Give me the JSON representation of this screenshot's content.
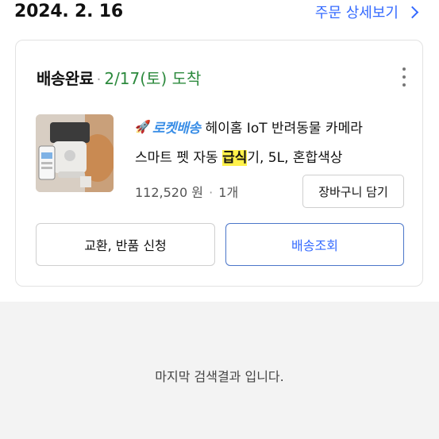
{
  "order": {
    "date": "2024. 2. 16",
    "detail_link_label": "주문 상세보기",
    "detail_link_icon": "chevron-right-icon"
  },
  "shipment": {
    "status": "배송완료",
    "separator": "·",
    "arrival": "2/17(토) 도착",
    "arrival_color": "#2d8a3e",
    "more_icon": "more-vertical-icon"
  },
  "product": {
    "thumbnail_icon": "product-thumbnail",
    "badge_icon": "rocket-icon",
    "badge_label": "로켓배송",
    "name_line1": "헤이홈 IoT 반려동물 카메라",
    "name_line2_prefix": "스마트 펫 자동 ",
    "name_line2_highlight": "급식",
    "name_line2_suffix": "기, 5L, 혼합색상",
    "price": "112,520 원",
    "separator": "·",
    "quantity": "1개"
  },
  "buttons": {
    "add_to_cart": "장바구니 담기",
    "exchange_return": "교환, 반품 신청",
    "track_delivery": "배송조회"
  },
  "footer": {
    "end_message": "마지막 검색결과 입니다."
  },
  "colors": {
    "accent": "#346aff",
    "highlight": "#fff14a",
    "rocket": "#3a8ee6"
  }
}
